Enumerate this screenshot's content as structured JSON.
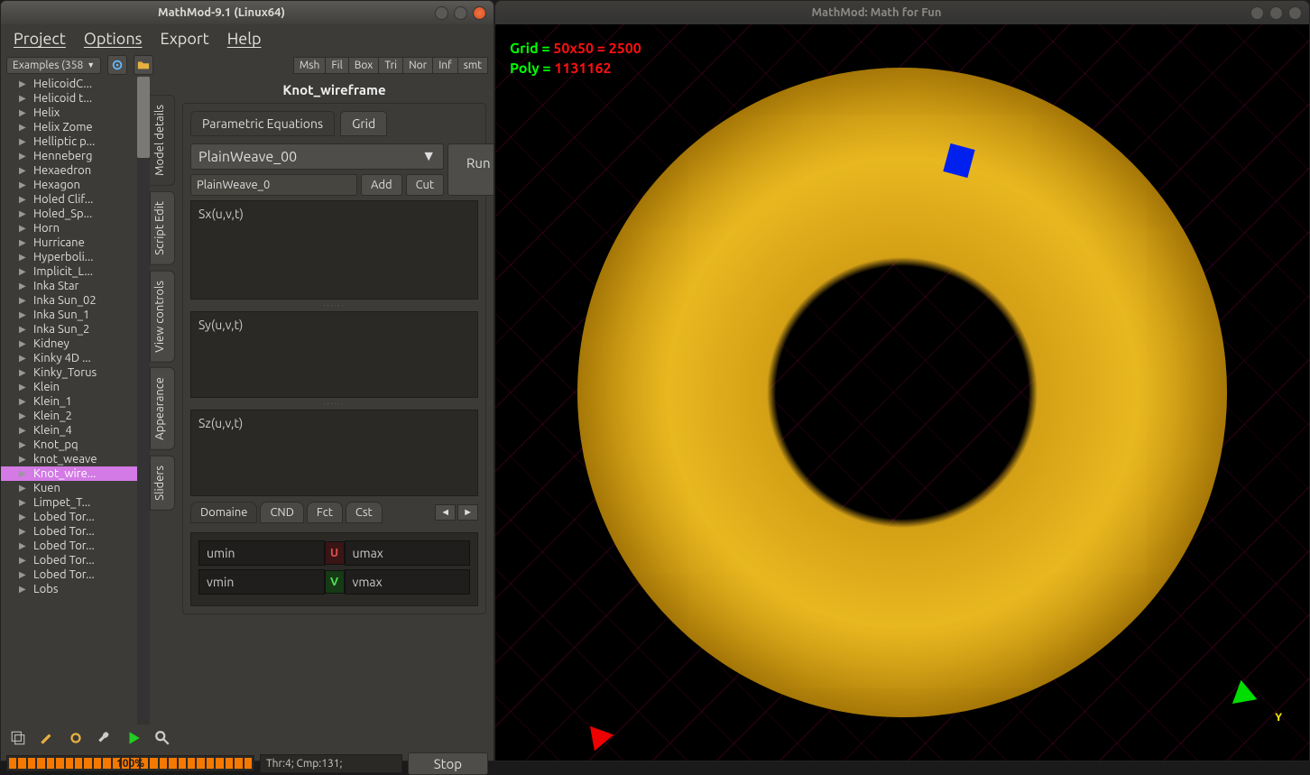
{
  "left_window": {
    "title": "MathMod-9.1 (Linux64)",
    "menu": {
      "project": "Project",
      "options": "Options",
      "export": "Export",
      "help": "Help"
    },
    "examples_label": "Examples (358",
    "seg_buttons": [
      "Msh",
      "Fil",
      "Box",
      "Tri",
      "Nor",
      "Inf",
      "smt"
    ],
    "tree": [
      "HelicoidC...",
      "Helicoid t...",
      "Helix",
      "Helix Zome",
      "Helliptic p...",
      "Henneberg",
      "Hexaedron",
      "Hexagon",
      "Holed Clif...",
      "Holed_Sp...",
      "Horn",
      "Hurricane",
      "Hyperboli...",
      "Implicit_L...",
      "Inka Star",
      "Inka Sun_02",
      "Inka Sun_1",
      "Inka Sun_2",
      "Kidney",
      "Kinky 4D ...",
      "Kinky_Torus",
      "Klein",
      "Klein_1",
      "Klein_2",
      "Klein_4",
      "Knot_pq",
      "knot_weave",
      "Knot_wire...",
      "Kuen",
      "Limpet_T...",
      "Lobed Tor...",
      "Lobed Tor...",
      "Lobed Tor...",
      "Lobed Tor...",
      "Lobed Tor...",
      "Lobs"
    ],
    "tree_selected_index": 27,
    "vtabs": [
      "Model details",
      "Script Edit",
      "View controls",
      "Appearance",
      "Sliders"
    ],
    "vtab_active_index": 0,
    "model_title": "Knot_wireframe",
    "htabs": {
      "param": "Parametric Equations",
      "grid": "Grid"
    },
    "htab_active": "param",
    "component_dropdown": "PlainWeave_00",
    "component_input": "PlainWeave_0",
    "add_label": "Add",
    "cut_label": "Cut",
    "run_label": "Run",
    "eq_labels": {
      "sx": "Sx(u,v,t)",
      "sy": "Sy(u,v,t)",
      "sz": "Sz(u,v,t)"
    },
    "sub_tabs": [
      "Domaine",
      "CND",
      "Fct",
      "Cst"
    ],
    "sub_tab_active_index": 0,
    "domain": {
      "umin": "umin",
      "umax": "umax",
      "vmin": "vmin",
      "vmax": "vmax",
      "u_badge": "U",
      "v_badge": "V"
    },
    "progress_pct": "100%",
    "status_text": "Thr:4; Cmp:131;",
    "stop_label": "Stop"
  },
  "right_window": {
    "title": "MathMod: Math for Fun",
    "overlay": {
      "grid_label": "Grid = ",
      "grid_val": "50x50 = 2500",
      "poly_label": "Poly = ",
      "poly_val": "1131162"
    },
    "y_axis": "Y"
  }
}
